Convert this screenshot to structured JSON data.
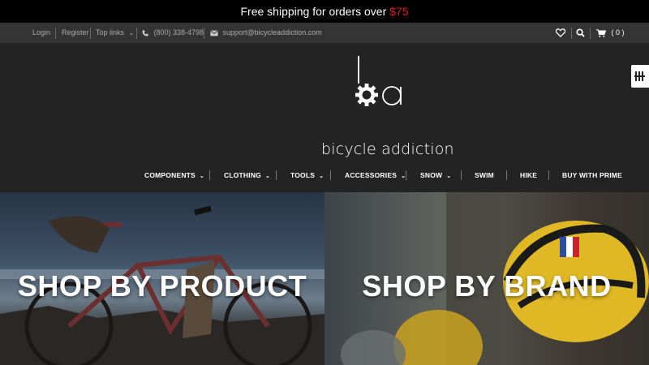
{
  "promo": {
    "text": "Free shipping for orders over ",
    "price": "$75"
  },
  "utility": {
    "login": "Login",
    "register": "Register",
    "top_links": "Top links",
    "phone": "(800) 338-4798",
    "email": "support@bicycleaddiction.com",
    "cart_count": "( 0 )"
  },
  "brand": {
    "name": "bicycle addiction"
  },
  "nav": {
    "items": [
      {
        "label": "COMPONENTS",
        "dropdown": true
      },
      {
        "label": "CLOTHING",
        "dropdown": true
      },
      {
        "label": "TOOLS",
        "dropdown": true
      },
      {
        "label": "ACCESSORIES",
        "dropdown": true
      },
      {
        "label": "SNOW",
        "dropdown": true
      },
      {
        "label": "SWIM",
        "dropdown": false
      },
      {
        "label": "HIKE",
        "dropdown": false
      },
      {
        "label": "BUY WITH PRIME",
        "dropdown": false
      }
    ]
  },
  "banners": {
    "product": "SHOP BY PRODUCT",
    "brand": "SHOP BY BRAND"
  },
  "colors": {
    "accent_red": "#e21d1d",
    "header_bg": "#232323",
    "util_bg": "#343434"
  }
}
